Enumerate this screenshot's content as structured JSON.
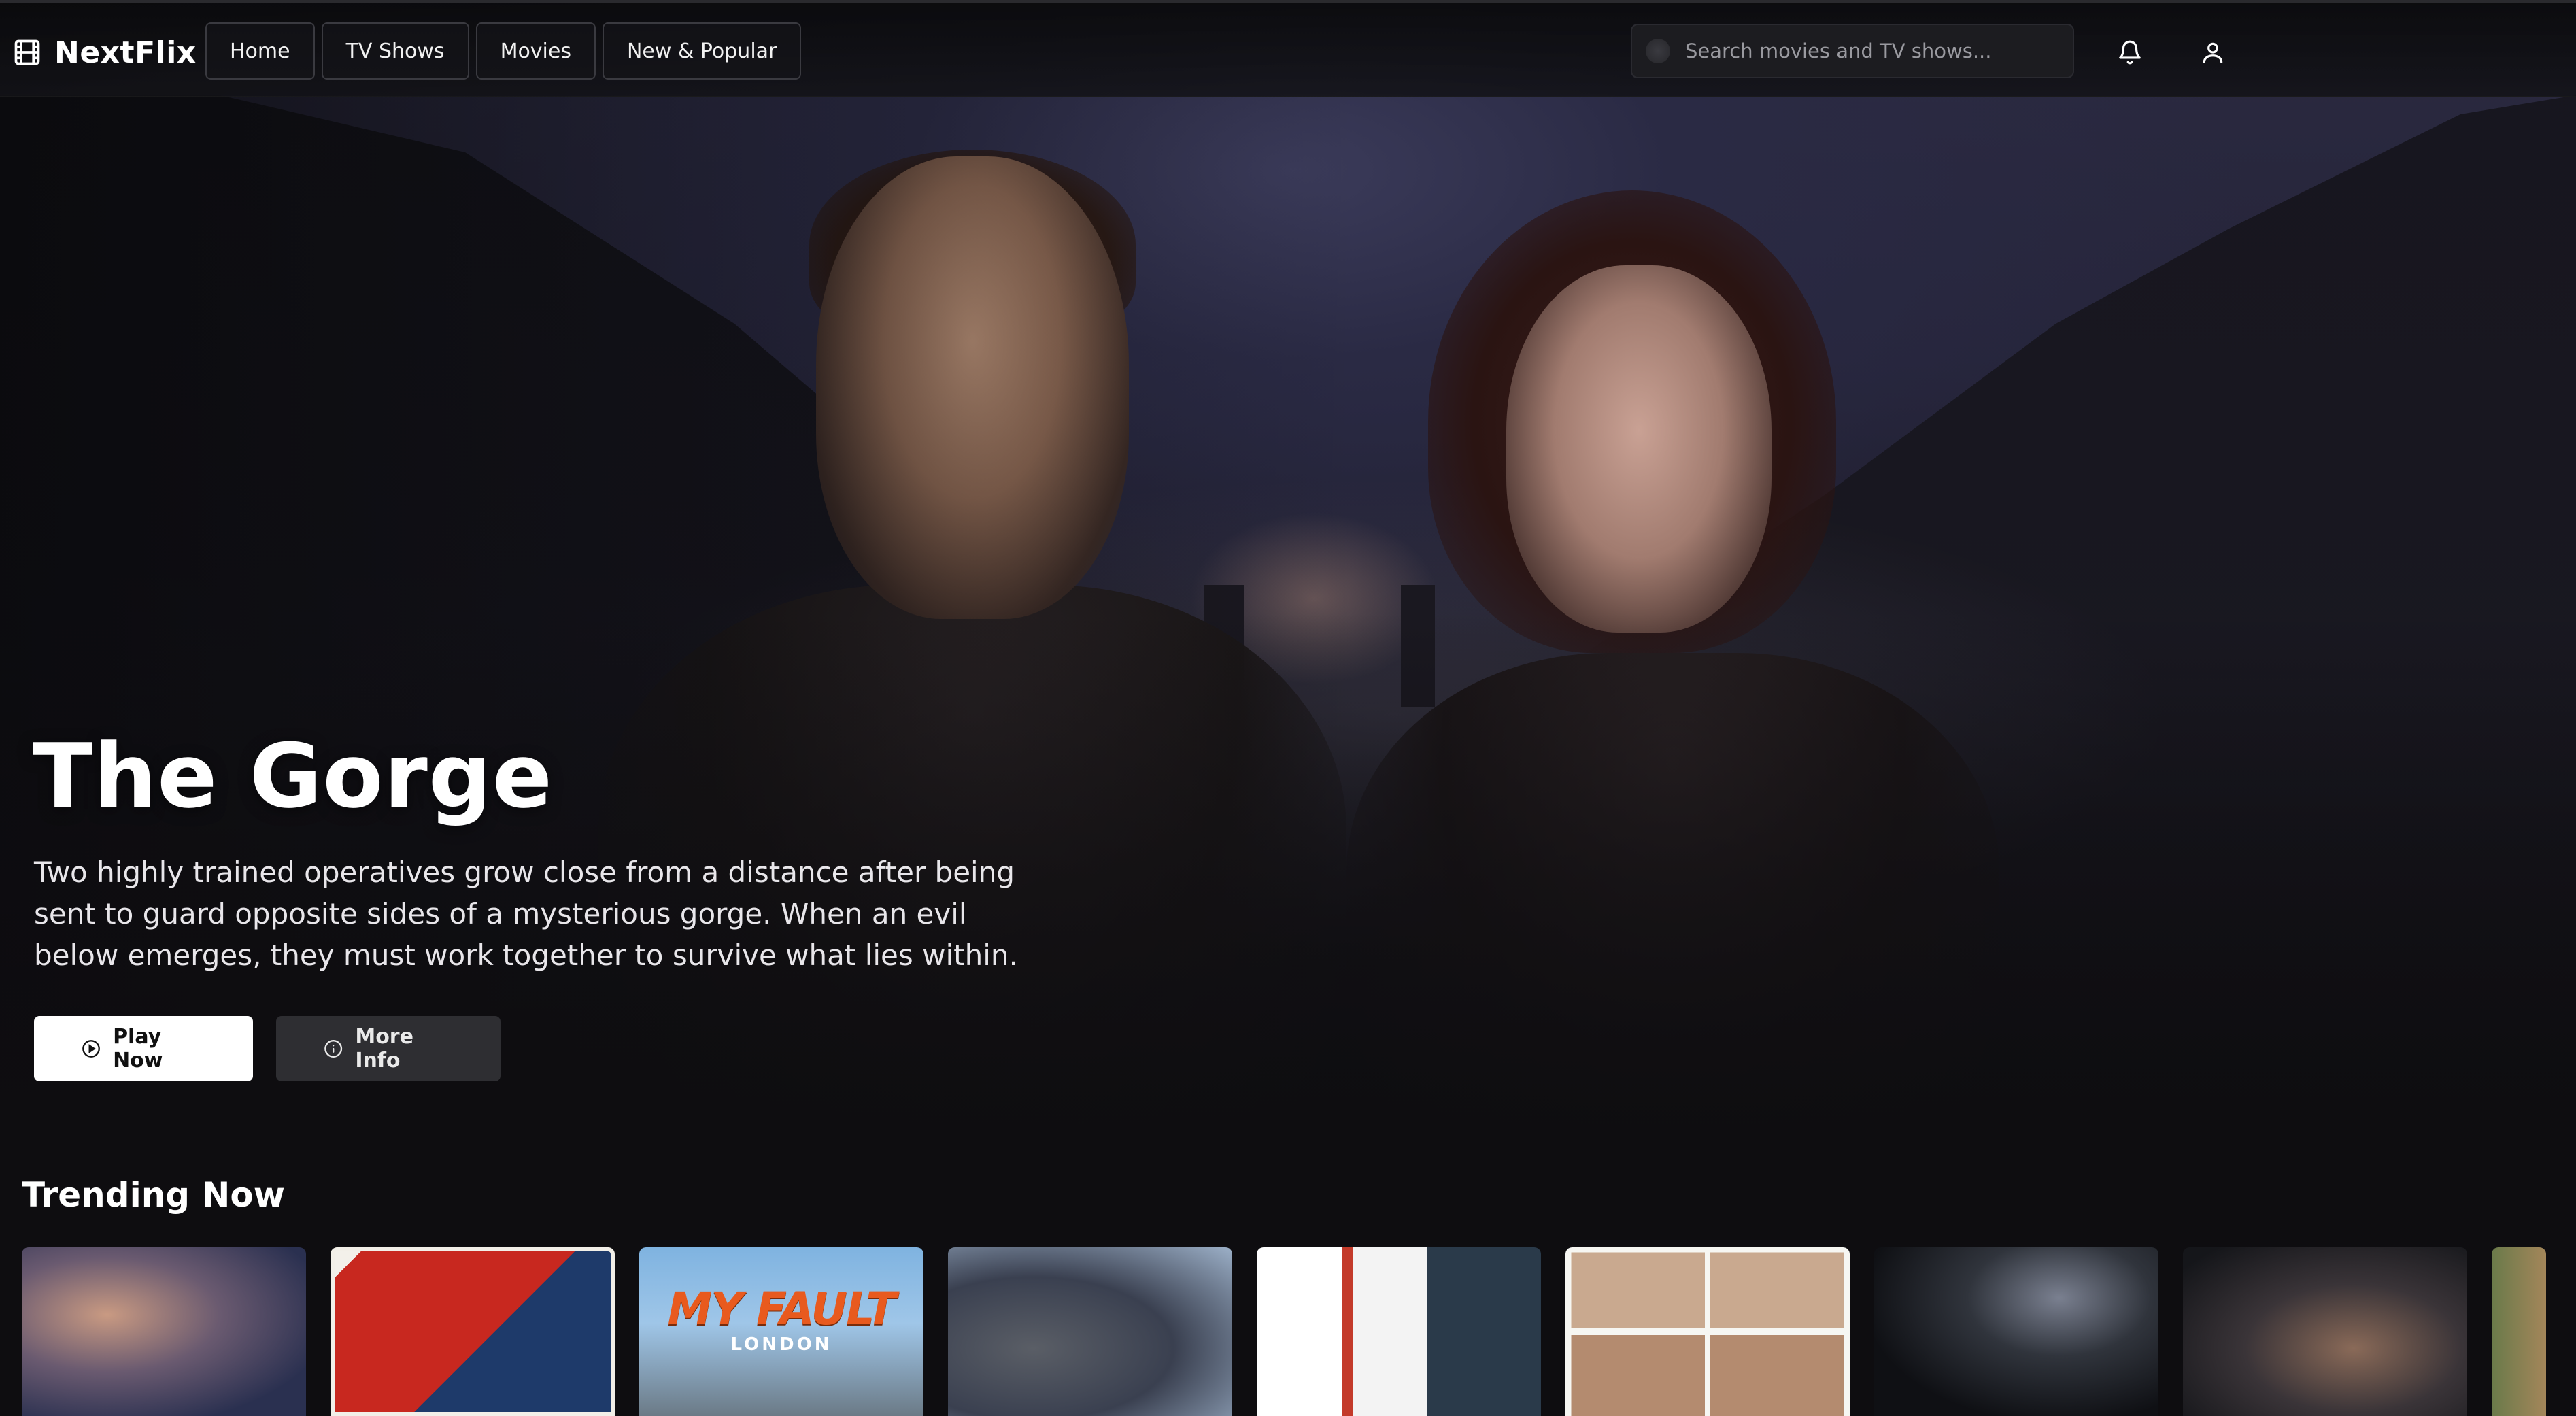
{
  "app": {
    "brand_name": "NextFlix",
    "brand_icon": "film-icon"
  },
  "nav": {
    "tabs": [
      {
        "label": "Home"
      },
      {
        "label": "TV Shows"
      },
      {
        "label": "Movies"
      },
      {
        "label": "New & Popular"
      }
    ],
    "search": {
      "placeholder": "Search movies and TV shows...",
      "value": ""
    },
    "icons": [
      "bell-icon",
      "user-icon"
    ]
  },
  "hero": {
    "title": "The Gorge",
    "description": "Two highly trained operatives grow close from a distance after being sent to guard opposite sides of a mysterious gorge. When an evil below emerges, they must work together to survive what lies within.",
    "buttons": {
      "play_label": "Play Now",
      "info_label": "More Info"
    }
  },
  "trending": {
    "title": "Trending Now",
    "cards": [
      {
        "text": "",
        "subtext": ""
      },
      {
        "text": "",
        "subtext": ""
      },
      {
        "text": "MY FAULT",
        "subtext": "LONDON"
      },
      {
        "text": "",
        "subtext": ""
      },
      {
        "text": "",
        "subtext": ""
      },
      {
        "text": "",
        "subtext": ""
      },
      {
        "text": "",
        "subtext": ""
      },
      {
        "text": "",
        "subtext": ""
      },
      {
        "text": "",
        "subtext": ""
      }
    ]
  },
  "colors": {
    "background": "#0e0d10",
    "play_button_bg": "#ffffff",
    "info_button_bg": "#2e2e32",
    "accent_title_text": "#e85a1e"
  }
}
